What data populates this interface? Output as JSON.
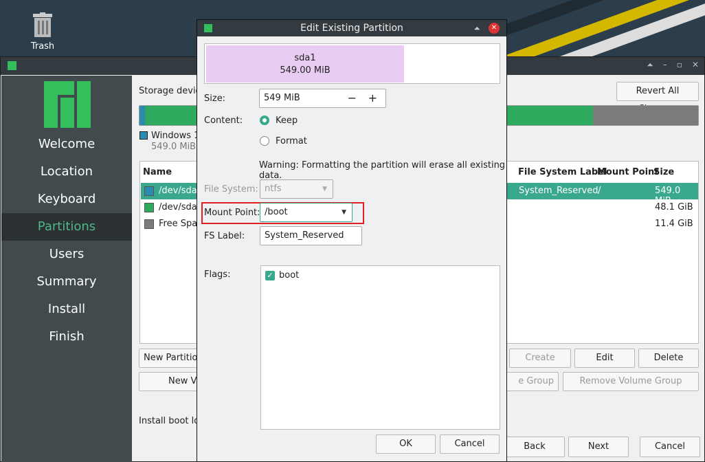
{
  "desktop": {
    "trash_label": "Trash"
  },
  "sidebar": {
    "items": [
      {
        "label": "Welcome"
      },
      {
        "label": "Location"
      },
      {
        "label": "Keyboard"
      },
      {
        "label": "Partitions"
      },
      {
        "label": "Users"
      },
      {
        "label": "Summary"
      },
      {
        "label": "Install"
      },
      {
        "label": "Finish"
      }
    ]
  },
  "main": {
    "storage_label": "Storage device",
    "revert_button": "Revert All Changes",
    "legend_name": "Windows 10",
    "legend_size": "549.0 MiB",
    "columns": {
      "name": "Name",
      "fs_label": "File System Label",
      "mount": "Mount Point",
      "size": "Size"
    },
    "rows": [
      {
        "name": "/dev/sda1",
        "fs_label": "System_Reserved",
        "mount": "/",
        "size": "549.0 MiB",
        "color": "#2c8ab0"
      },
      {
        "name": "/dev/sda2",
        "fs_label": "",
        "mount": "",
        "size": "48.1 GiB",
        "color": "#2eaa5e"
      },
      {
        "name": "Free Space",
        "fs_label": "",
        "mount": "",
        "size": "11.4 GiB",
        "color": "#7b7b7b"
      }
    ],
    "buttons": {
      "new_partition": "New Partition",
      "create": "Create",
      "edit": "Edit",
      "delete": "Delete",
      "new_volume": "New Vo",
      "edit_group": "e Group",
      "remove_group": "Remove Volume Group",
      "back": "Back",
      "next": "Next",
      "cancel": "Cancel"
    },
    "boot_loader": "Install boot loa",
    "bar": {
      "accent": "#2eaa5e",
      "sda1_color": "#2c8ab0"
    }
  },
  "dialog": {
    "title": "Edit Existing Partition",
    "preview_name": "sda1",
    "preview_size": "549.00 MiB",
    "size_label": "Size:",
    "size_value": "549 MiB",
    "content_label": "Content:",
    "keep_label": "Keep",
    "format_label": "Format",
    "warning": "Warning: Formatting the partition will erase all existing data.",
    "fs_label": "File System:",
    "fs_value": "ntfs",
    "mount_label": "Mount Point:",
    "mount_value": "/boot",
    "fslabel_label": "FS Label:",
    "fslabel_value": "System_Reserved",
    "flags_label": "Flags:",
    "flag_boot": "boot",
    "ok": "OK",
    "cancel": "Cancel"
  },
  "colors": {
    "accent": "#35bf5c",
    "highlight": "#e02020",
    "sidebar_active": "#50b78a"
  }
}
